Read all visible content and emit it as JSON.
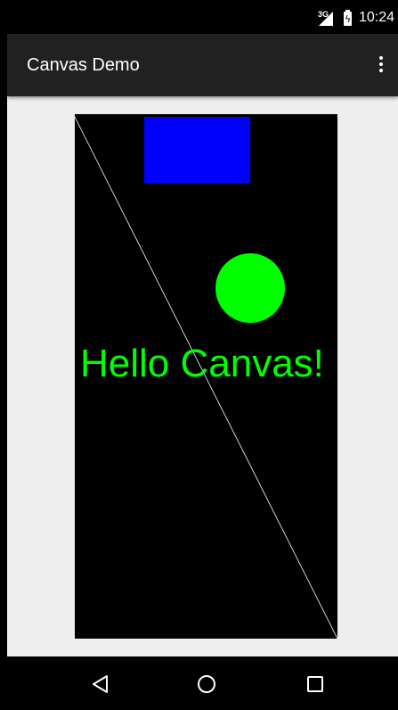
{
  "status_bar": {
    "network_type": "3G",
    "time": "10:24"
  },
  "app_bar": {
    "title": "Canvas Demo",
    "overflow_icon": "more-vert-icon"
  },
  "canvas": {
    "background_color": "#000000",
    "text": "Hello Canvas!",
    "text_color": "#00ff00",
    "rect_color": "#0000ff",
    "circle_color": "#00ff00",
    "line_color": "#ffffff"
  },
  "nav_bar": {
    "back_icon": "back-triangle-icon",
    "home_icon": "home-circle-icon",
    "recents_icon": "recents-square-icon"
  }
}
